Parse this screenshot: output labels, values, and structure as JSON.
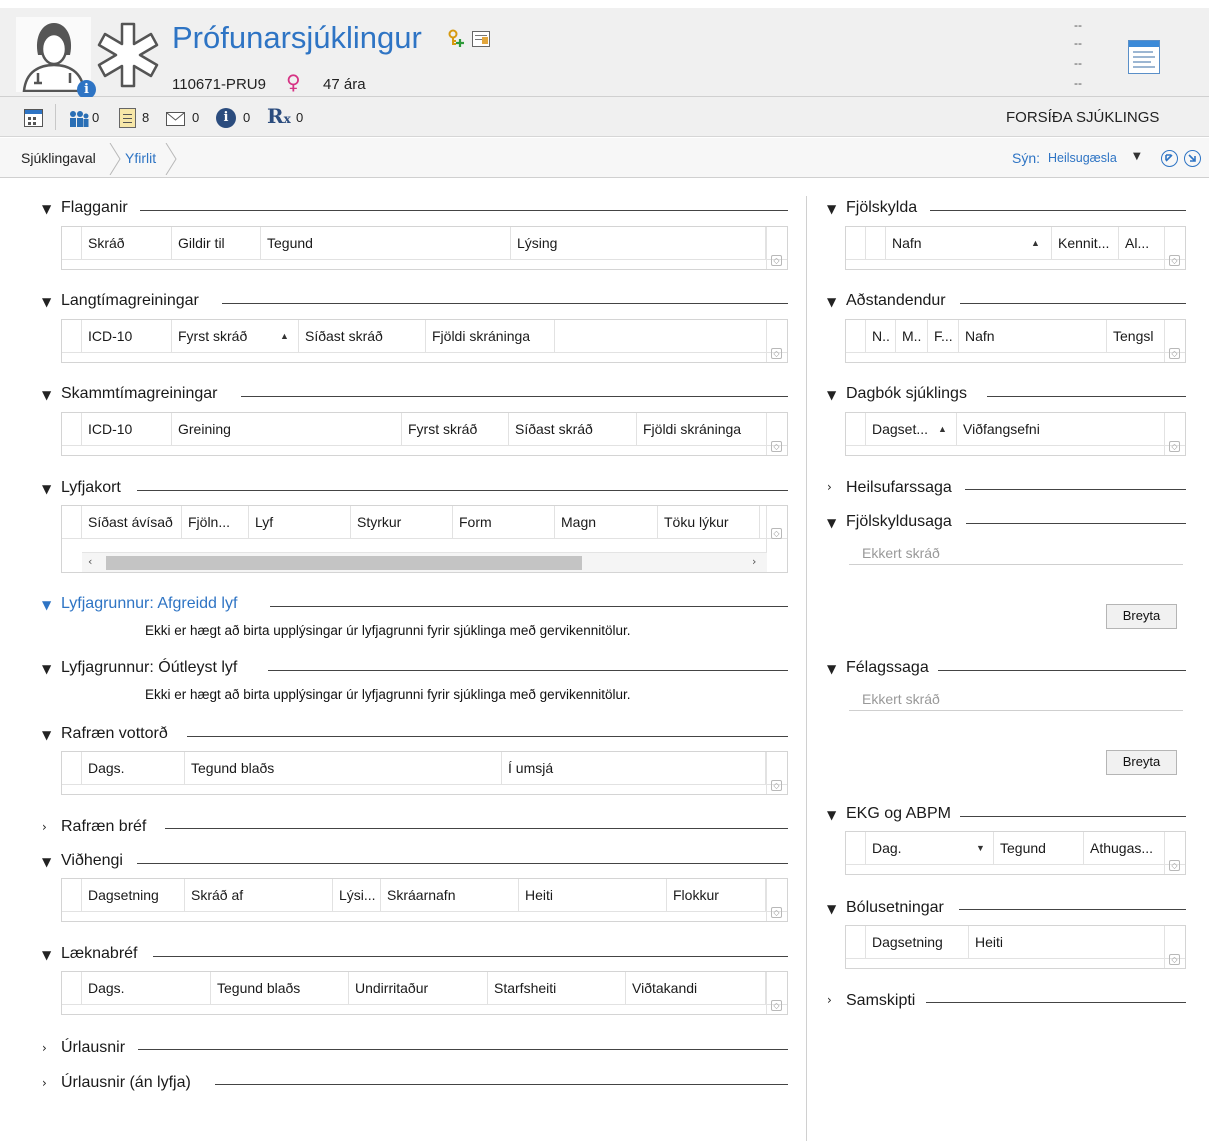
{
  "patient": {
    "name": "Prófunarsjúklingur",
    "id": "110671-PRU9",
    "gender_symbol": "♀",
    "age": "47 ára",
    "status_lines": [
      "--",
      "--",
      "--",
      "--"
    ]
  },
  "toolbar": {
    "relations_count": "0",
    "documents_count": "8",
    "messages_count": "0",
    "info_count": "0",
    "prescriptions_count": "0",
    "rx_label": "R",
    "page_label": "FORSÍÐA SJÚKLINGS"
  },
  "breadcrumb": {
    "items": [
      "Sjúklingaval",
      "Yfirlit"
    ],
    "view_label": "Sýn:",
    "view_value": "Heilsugæsla"
  },
  "left": {
    "flagganir": {
      "title": "Flagganir",
      "cols": [
        "Skráð",
        "Gildir til",
        "Tegund",
        "Lýsing"
      ]
    },
    "langtima": {
      "title": "Langtímagreiningar",
      "cols": [
        "ICD-10",
        "Fyrst skráð",
        "Síðast skráð",
        "Fjöldi skráninga"
      ]
    },
    "skammtima": {
      "title": "Skammtímagreiningar",
      "cols": [
        "ICD-10",
        "Greining",
        "Fyrst skráð",
        "Síðast skráð",
        "Fjöldi skráninga"
      ]
    },
    "lyfjakort": {
      "title": "Lyfjakort",
      "cols": [
        "Síðast ávísað",
        "Fjöln...",
        "Lyf",
        "Styrkur",
        "Form",
        "Magn",
        "Töku lýkur"
      ]
    },
    "afgreidd": {
      "title": "Lyfjagrunnur: Afgreidd lyf",
      "message": "Ekki er hægt að birta upplýsingar úr lyfjagrunni fyrir sjúklinga með gervikennitölur."
    },
    "outleyst": {
      "title": "Lyfjagrunnur: Óútleyst lyf",
      "message": "Ekki er hægt að birta upplýsingar úr lyfjagrunni fyrir sjúklinga með gervikennitölur."
    },
    "vottord": {
      "title": "Rafræn vottorð",
      "cols": [
        "Dags.",
        "Tegund blaðs",
        "Í umsjá"
      ]
    },
    "bref": {
      "title": "Rafræn bréf"
    },
    "vidhengi": {
      "title": "Viðhengi",
      "cols": [
        "Dagsetning",
        "Skráð af",
        "Lýsi...",
        "Skráarnafn",
        "Heiti",
        "Flokkur"
      ]
    },
    "laeknabref": {
      "title": "Læknabréf",
      "cols": [
        "Dags.",
        "Tegund blaðs",
        "Undirritaður",
        "Starfsheiti",
        "Viðtakandi"
      ]
    },
    "urlausnir": {
      "title": "Úrlausnir"
    },
    "urlausnir_an": {
      "title": "Úrlausnir (án lyfja)"
    }
  },
  "right": {
    "fjolskylda": {
      "title": "Fjölskylda",
      "cols": [
        "Nafn",
        "Kennit...",
        "Al..."
      ]
    },
    "adstandendur": {
      "title": "Aðstandendur",
      "cols": [
        "N..",
        "M..",
        "F...",
        "Nafn",
        "Tengsl"
      ]
    },
    "dagbok": {
      "title": "Dagbók sjúklings",
      "cols": [
        "Dagset...",
        "Viðfangsefni"
      ]
    },
    "heilsufarssaga": {
      "title": "Heilsufarssaga"
    },
    "fjolskyldusaga": {
      "title": "Fjölskyldusaga",
      "empty": "Ekkert skráð",
      "button": "Breyta"
    },
    "felagssaga": {
      "title": "Félagssaga",
      "empty": "Ekkert skráð",
      "button": "Breyta"
    },
    "ekg": {
      "title": "EKG og ABPM",
      "cols": [
        "Dag.",
        "Tegund",
        "Athugas..."
      ]
    },
    "bolusetningar": {
      "title": "Bólusetningar",
      "cols": [
        "Dagsetning",
        "Heiti"
      ]
    },
    "samskipti": {
      "title": "Samskipti"
    }
  },
  "colors": {
    "accent": "#2e74c4",
    "gender": "#d63384",
    "header_bg": "#f0f0f0"
  }
}
